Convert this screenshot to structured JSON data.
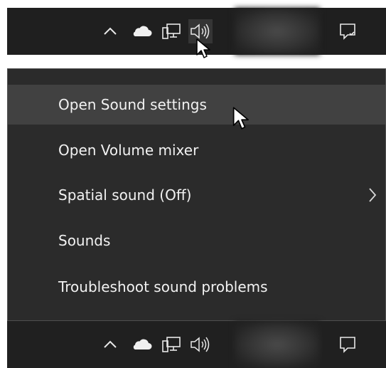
{
  "context_menu": {
    "items": [
      {
        "label": "Open Sound settings",
        "highlighted": true,
        "has_submenu": false
      },
      {
        "label": "Open Volume mixer",
        "highlighted": false,
        "has_submenu": false
      },
      {
        "label": "Spatial sound (Off)",
        "highlighted": false,
        "has_submenu": true
      },
      {
        "label": "Sounds",
        "highlighted": false,
        "has_submenu": false
      },
      {
        "label": "Troubleshoot sound problems",
        "highlighted": false,
        "has_submenu": false
      }
    ]
  },
  "taskbar_top": {
    "tray_icons": [
      "chevron-up-icon",
      "onedrive-cloud-icon",
      "network-icon",
      "volume-icon"
    ],
    "hovered_icon": "volume-icon",
    "action_center_icon": "action-center-icon"
  },
  "taskbar_bottom": {
    "tray_icons": [
      "chevron-up-icon",
      "onedrive-cloud-icon",
      "network-icon",
      "volume-icon"
    ],
    "action_center_icon": "action-center-icon"
  },
  "colors": {
    "taskbar": "#1f1f1f",
    "menu_background": "#2b2b2b",
    "menu_highlight": "#414141",
    "menu_border": "#4f4f4f",
    "text": "#f2f2f2",
    "icon": "#e8e8e8"
  }
}
